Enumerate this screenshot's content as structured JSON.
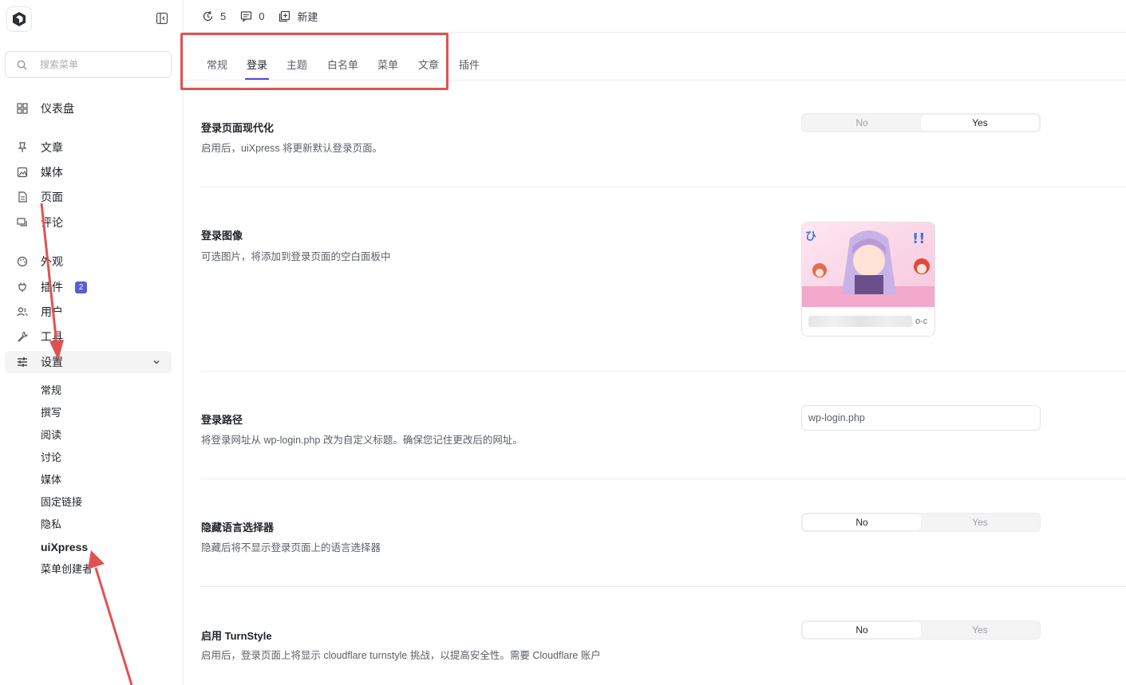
{
  "sidebar": {
    "search_placeholder": "搜索菜单",
    "dashboard": "仪表盘",
    "items": [
      {
        "label": "文章"
      },
      {
        "label": "媒体"
      },
      {
        "label": "页面"
      },
      {
        "label": "评论"
      },
      {
        "label": "外观"
      },
      {
        "label": "插件",
        "badge": "2"
      },
      {
        "label": "用户"
      },
      {
        "label": "工具"
      },
      {
        "label": "设置"
      }
    ],
    "settings_submenu": [
      "常规",
      "撰写",
      "阅读",
      "讨论",
      "媒体",
      "固定链接",
      "隐私",
      "uiXpress",
      "菜单创建者"
    ]
  },
  "topbar": {
    "updates_count": "5",
    "comments_count": "0",
    "new_label": "新建"
  },
  "tabs": [
    "常规",
    "登录",
    "主题",
    "白名单",
    "菜单",
    "文章",
    "插件"
  ],
  "active_tab": "登录",
  "settings": {
    "modern_login": {
      "title": "登录页面现代化",
      "desc": "启用后，uiXpress 将更新默认登录页面。",
      "no": "No",
      "yes": "Yes",
      "value": "Yes"
    },
    "login_image": {
      "title": "登录图像",
      "desc": "可选图片，将添加到登录页面的空白面板中",
      "filename_suffix": "o-c"
    },
    "login_path": {
      "title": "登录路径",
      "desc": "将登录网址从 wp-login.php 改为自定义标题。确保您记住更改后的网址。",
      "value": "wp-login.php"
    },
    "hide_language": {
      "title": "隐藏语言选择器",
      "desc": "隐藏后将不显示登录页面上的语言选择器",
      "no": "No",
      "yes": "Yes",
      "value": "No"
    },
    "turnstyle": {
      "title": "启用 TurnStyle",
      "desc": "启用后，登录页面上将显示 cloudflare turnstyle 挑战，以提高安全性。需要 Cloudflare 账户",
      "no": "No",
      "yes": "Yes",
      "value": "No"
    }
  },
  "colors": {
    "accent": "#4f46e5",
    "badge": "#5b5bd6",
    "annotation": "#e05252"
  }
}
